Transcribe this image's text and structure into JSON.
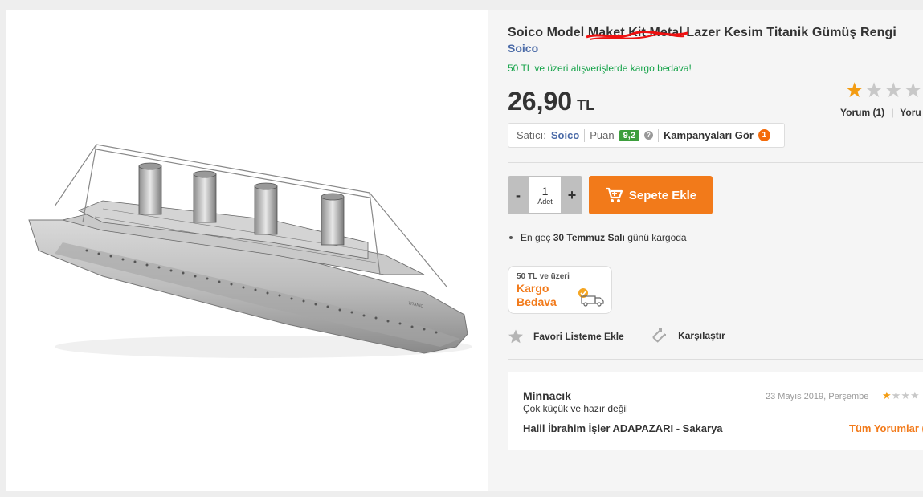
{
  "product": {
    "title": "Soico Model Maket Kit Metal Lazer Kesim Titanik Gümüş Rengi",
    "brand": "Soico",
    "shipping_promo": "50 TL ve üzeri alışverişlerde kargo bedava!",
    "price_value": "26,90",
    "price_currency": "TL",
    "rating_stars": 1,
    "rating_max": 5,
    "review_link": "Yorum (1)",
    "question_link": "Yoru",
    "image_alt": "TITANIC"
  },
  "seller": {
    "label": "Satıcı:",
    "name": "Soico",
    "score_label": "Puan",
    "score": "9,2",
    "help": "?",
    "campaigns": "Kampanyaları Gör",
    "campaign_count": "1"
  },
  "cart": {
    "minus": "-",
    "plus": "+",
    "quantity": "1",
    "unit": "Adet",
    "add_button": "Sepete Ekle"
  },
  "delivery": {
    "prefix": "En geç",
    "date": "30 Temmuz Salı",
    "suffix": "günü kargoda"
  },
  "free_shipping": {
    "small": "50 TL ve üzeri",
    "line1": "Kargo",
    "line2": "Bedava"
  },
  "actions": {
    "favorite": "Favori Listeme Ekle",
    "compare": "Karşılaştır"
  },
  "review": {
    "name": "Minnacık",
    "text": "Çok küçük ve hazır değil",
    "date": "23 Mayıs 2019, Perşembe",
    "stars": 1,
    "author": "Halil İbrahim İşler ADAPAZARI - Sakarya",
    "all_reviews": "Tüm Yorumlar ("
  },
  "colors": {
    "accent": "#f27a1a",
    "brand_blue": "#4a6aa7",
    "promo_green": "#16a34a",
    "star": "#f39c12",
    "score_green": "#3c9e3c"
  }
}
